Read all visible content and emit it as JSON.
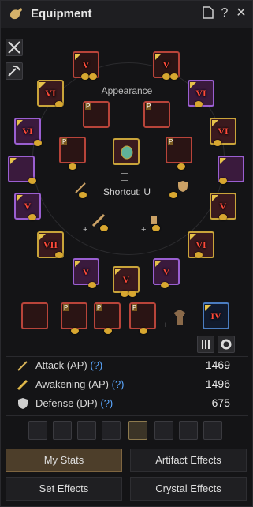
{
  "window": {
    "title": "Equipment"
  },
  "appearance_label": "Appearance",
  "shortcut_label": "Shortcut: U",
  "slot_ranks": {
    "roman5": "V",
    "roman6": "VI",
    "roman7": "VII",
    "roman4": "IV"
  },
  "stats": [
    {
      "label": "Attack (AP)",
      "help": "(?)",
      "value": "1469"
    },
    {
      "label": "Awakening (AP)",
      "help": "(?)",
      "value": "1496"
    },
    {
      "label": "Defense (DP)",
      "help": "(?)",
      "value": "675"
    }
  ],
  "buttons": {
    "my_stats": "My Stats",
    "artifact_effects": "Artifact Effects",
    "set_effects": "Set Effects",
    "crystal_effects": "Crystal Effects"
  },
  "colors": {
    "accent": "#c9a43a",
    "help": "#5aa7ff",
    "rank": "#ff4a3a",
    "purple_border": "#9a5fd1"
  }
}
